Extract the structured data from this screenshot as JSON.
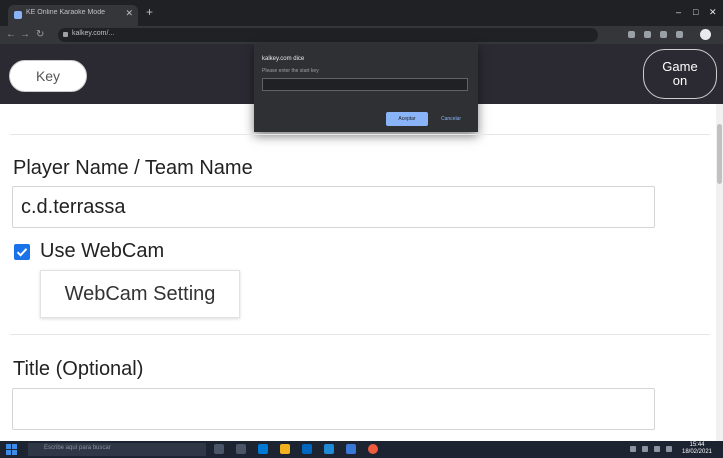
{
  "browser": {
    "tab_title": "KE Online Karaoke Mode",
    "url": "kalkey.com/...",
    "new_tab": "+",
    "window_controls": {
      "minimize": "–",
      "maximize": "□",
      "close": "✕"
    },
    "nav": {
      "back": "←",
      "forward": "→",
      "reload": "↻"
    }
  },
  "header": {
    "key_button": "Key",
    "game_button": "Game on",
    "background_color": "#2b2a33"
  },
  "dialog": {
    "title": "kalkey.com dice",
    "message": "Please enter the start key",
    "input_value": "",
    "ok_label": "Aceptar",
    "cancel_label": "Cancelar"
  },
  "form": {
    "player_label": "Player Name / Team Name",
    "player_value": "c.d.terrassa",
    "webcam_checked": true,
    "webcam_label": "Use WebCam",
    "webcam_settings_button": "WebCam Setting",
    "title_label": "Title (Optional)",
    "title_value": "",
    "accent_color": "#1a73e8"
  },
  "taskbar": {
    "search_placeholder": "Escribe aquí para buscar",
    "time": "15:44",
    "date": "18/02/2021"
  }
}
